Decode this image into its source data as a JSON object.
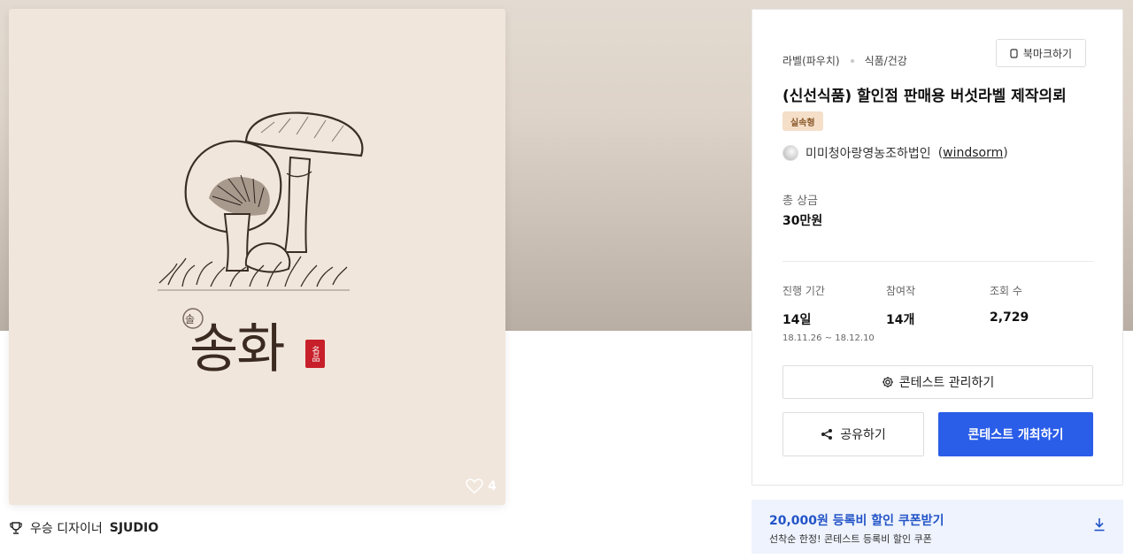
{
  "artwork": {
    "likes": "4",
    "brand_text": "송화",
    "seal_text": "名品",
    "badge_text": "솔"
  },
  "winner": {
    "prefix": "우승 디자이너",
    "name": "SJUDIO"
  },
  "panel": {
    "category": "라벨(파우치)",
    "subcategory": "식품/건강",
    "bookmark_label": "북마크하기",
    "title": "(신선식품) 할인점 판매용 버섯라벨 제작의뢰",
    "tag": "실속형",
    "host_name": "미미청아랑영농조하법인",
    "host_id": "windsorm",
    "prize_label": "총 상금",
    "prize_value": "30만원",
    "stats": [
      {
        "label": "진행 기간",
        "value": "14일",
        "sub": "18.11.26 ~ 18.12.10"
      },
      {
        "label": "참여작",
        "value": "14개"
      },
      {
        "label": "조회 수",
        "value": "2,729"
      }
    ],
    "manage_label": "콘테스트 관리하기",
    "share_label": "공유하기",
    "host_button_label": "콘테스트 개최하기"
  },
  "coupon": {
    "title": "20,000원 등록비 할인 쿠폰받기",
    "subtitle": "선착순 한정! 콘테스트 등록비 할인 쿠폰"
  },
  "colors": {
    "primary": "#2a5de8",
    "coupon_text": "#2354c7",
    "coupon_bg": "#eef3fd",
    "tag_bg": "#f5dfc9",
    "seal_red": "#c8202a"
  }
}
